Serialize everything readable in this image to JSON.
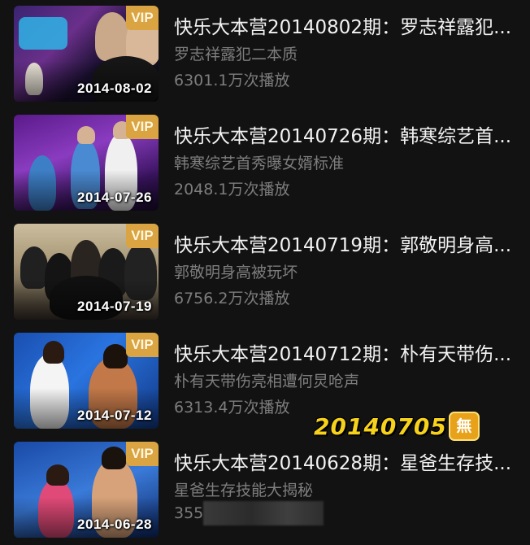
{
  "items": [
    {
      "title": "快乐大本营20140802期：罗志祥露犯...",
      "subtitle": "罗志祥露犯二本质",
      "plays": "6301.1万次播放",
      "date": "2014-08-02",
      "badge": "VIP",
      "thumb_colors": [
        "#2a1a4a",
        "#d8c7b0",
        "#f0f0f0"
      ]
    },
    {
      "title": "快乐大本营20140726期：韩寒综艺首...",
      "subtitle": "韩寒综艺首秀曝女婿标准",
      "plays": "2048.1万次播放",
      "date": "2014-07-26",
      "badge": "VIP",
      "thumb_colors": [
        "#7a2aa8",
        "#3a78b8",
        "#d9c2a6"
      ]
    },
    {
      "title": "快乐大本营20140719期：郭敬明身高...",
      "subtitle": "郭敬明身高被玩坏",
      "plays": "6756.2万次播放",
      "date": "2014-07-19",
      "badge": "VIP",
      "thumb_colors": [
        "#c8b89a",
        "#1c1c1c",
        "#e6d2be"
      ]
    },
    {
      "title": "快乐大本营20140712期：朴有天带伤...",
      "subtitle": "朴有天带伤亮相遭何炅呛声",
      "plays": "6313.4万次播放",
      "date": "2014-07-12",
      "badge": "VIP",
      "thumb_colors": [
        "#1f5fc8",
        "#f4f4f4",
        "#b86a3a"
      ]
    },
    {
      "title": "快乐大本营20140628期：星爸生存技...",
      "subtitle": "星爸生存技能大揭秘",
      "plays": "355",
      "date": "2014-06-28",
      "badge": "VIP",
      "thumb_colors": [
        "#1c56b8",
        "#e64a7a",
        "#d9a07a"
      ]
    }
  ],
  "watermark": {
    "text": "20140705",
    "badge": "無"
  }
}
